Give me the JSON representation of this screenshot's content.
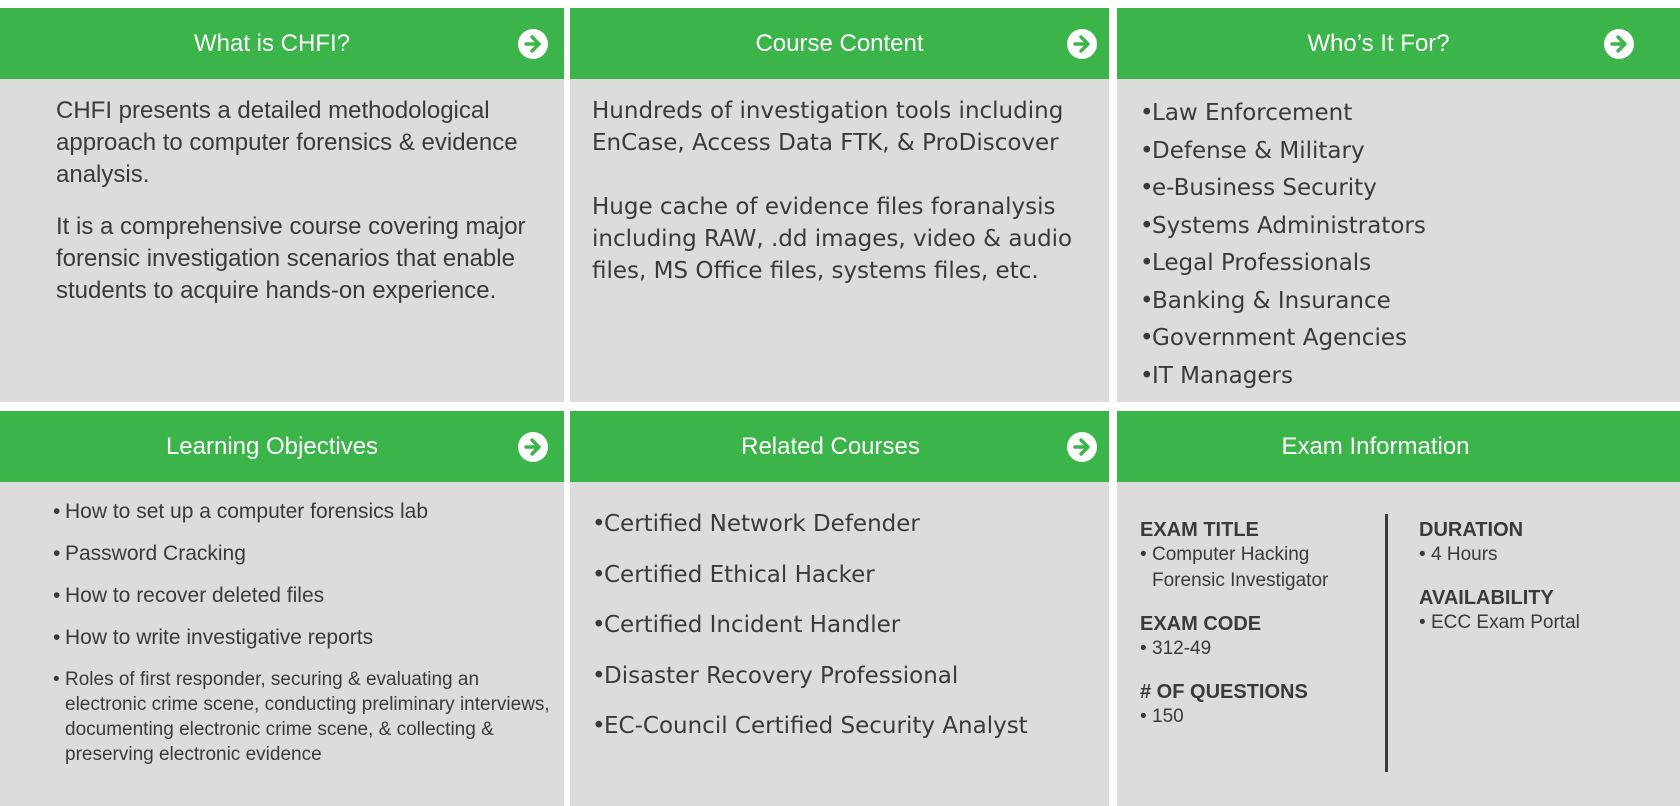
{
  "colors": {
    "header_green": "#3bb54a",
    "panel_gray": "#dcdcdc",
    "text": "#3a3a3a"
  },
  "panels": {
    "what_is": {
      "title": "What is CHFI?",
      "paragraphs": [
        "CHFI presents a detailed methodological approach to computer forensics & evidence analysis.",
        "It is a comprehensive course covering major forensic investigation scenarios that enable students to acquire hands-on experience."
      ]
    },
    "course_content": {
      "title": "Course Content",
      "paragraphs": [
        "Hundreds of investigation tools including EnCase, Access Data FTK, & ProDiscover",
        "Huge cache of evidence files foranalysis including RAW, .dd images, video & audio files, MS  Office files, systems files, etc."
      ]
    },
    "who_for": {
      "title": "Who’s It For?",
      "items": [
        "Law Enforcement",
        "Defense & Military",
        "e-Business Security",
        "Systems Administrators",
        "Legal Professionals",
        "Banking & Insurance",
        "Government Agencies",
        "IT Managers"
      ]
    },
    "learning": {
      "title": "Learning Objectives",
      "items": [
        "How to set up a computer forensics lab",
        "Password Cracking",
        "How to recover deleted files",
        "How to write investigative reports",
        "Roles of first responder, securing & evaluating an electronic crime scene, conducting preliminary interviews, documenting electronic crime scene, & collecting & preserving electronic evidence"
      ]
    },
    "related": {
      "title": "Related Courses",
      "items": [
        "Certified Network Defender",
        "Certified Ethical Hacker",
        "Certified Incident Handler",
        "Disaster Recovery Professional",
        "EC-Council Certified Security Analyst"
      ]
    },
    "exam": {
      "title": "Exam Information",
      "exam_title_label": "EXAM TITLE",
      "exam_title_value": "Computer Hacking Forensic Investigator",
      "exam_code_label": "EXAM CODE",
      "exam_code_value": "312-49",
      "questions_label": "# OF QUESTIONS",
      "questions_value": "150",
      "duration_label": "DURATION",
      "duration_value": "4 Hours",
      "availability_label": "AVAILABILITY",
      "availability_value": "ECC Exam Portal"
    }
  },
  "icons": {
    "arrow": "arrow-right-circle-icon"
  }
}
